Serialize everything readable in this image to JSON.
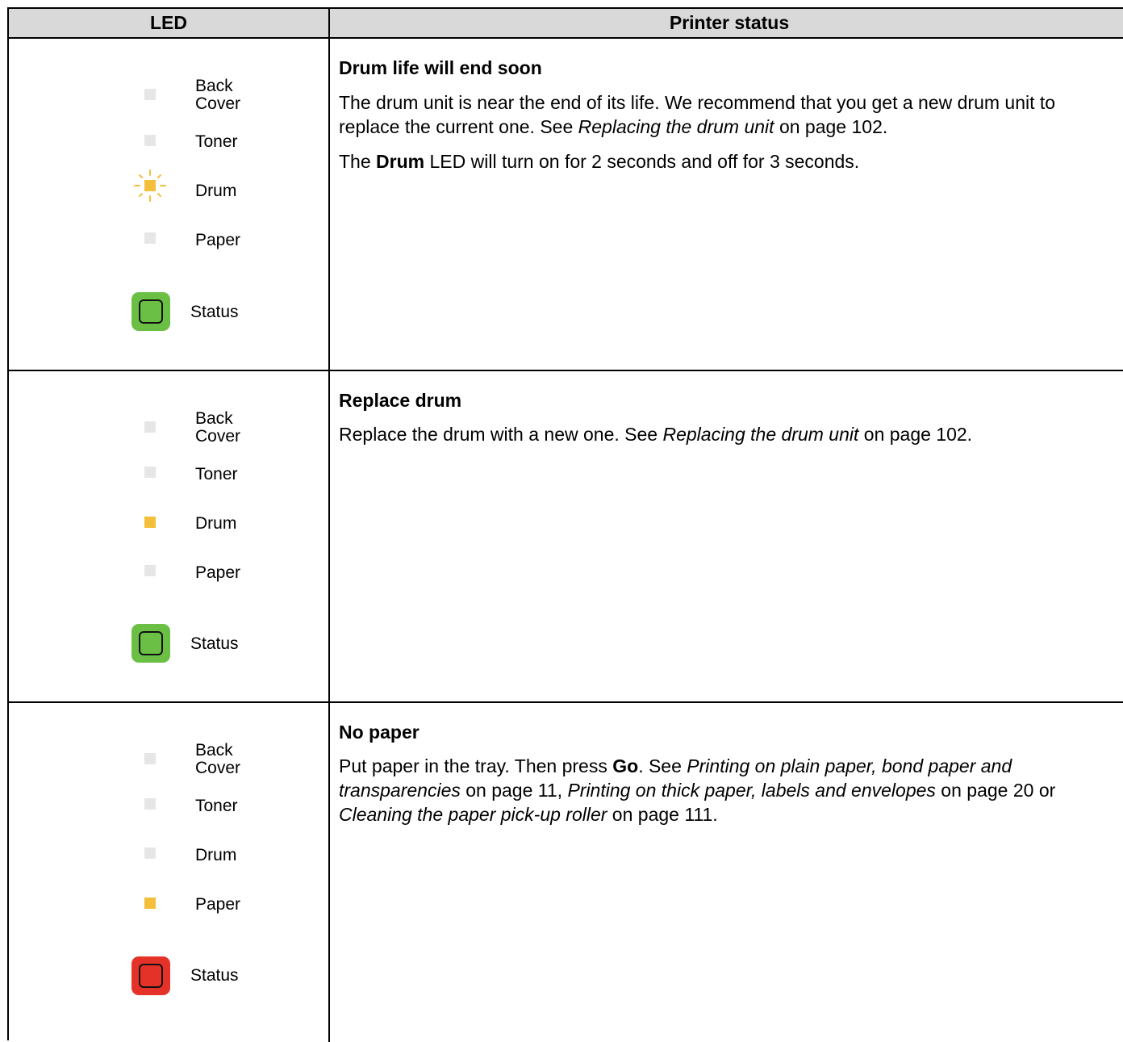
{
  "header": {
    "led": "LED",
    "status": "Printer status"
  },
  "led_labels": {
    "back_cover_1": "Back",
    "back_cover_2": "Cover",
    "toner": "Toner",
    "drum": "Drum",
    "paper": "Paper",
    "status": "Status"
  },
  "colors": {
    "amber": "#f4bf3b",
    "off": "#e6e6e6",
    "green": "#6cbf45",
    "red": "#e53228"
  },
  "rows": [
    {
      "title": "Drum life will end soon",
      "leds": {
        "back_cover": "off",
        "toner": "off",
        "drum": "amber-blinking",
        "paper": "off",
        "status": "green"
      },
      "p1": "The drum unit is near the end of its life. We recommend that you get a new drum unit to replace the current one. See ",
      "p1_link": "Replacing the drum unit",
      "p1_end": " on page 102.",
      "p2_a": "The ",
      "p2_bold": "Drum",
      "p2_b": " LED will turn on for 2 seconds and off for 3 seconds."
    },
    {
      "title": "Replace drum",
      "leds": {
        "back_cover": "off",
        "toner": "off",
        "drum": "amber",
        "paper": "off",
        "status": "green"
      },
      "p1": "Replace the drum with a new one. See ",
      "p1_link": "Replacing the drum unit",
      "p1_end": " on page 102."
    },
    {
      "title": "No paper",
      "leds": {
        "back_cover": "off",
        "toner": "off",
        "drum": "off",
        "paper": "amber",
        "status": "red"
      },
      "p1": "Put paper in the tray. Then press ",
      "p1_bold": "Go",
      "p1_b": ". See ",
      "link1": "Printing on plain paper, bond paper and transparencies",
      "t1": " on page 11, ",
      "link2": "Printing on thick paper, labels and envelopes",
      "t2": " on page 20 or ",
      "link3": "Cleaning the paper pick-up roller",
      "t3": " on page 111."
    }
  ]
}
